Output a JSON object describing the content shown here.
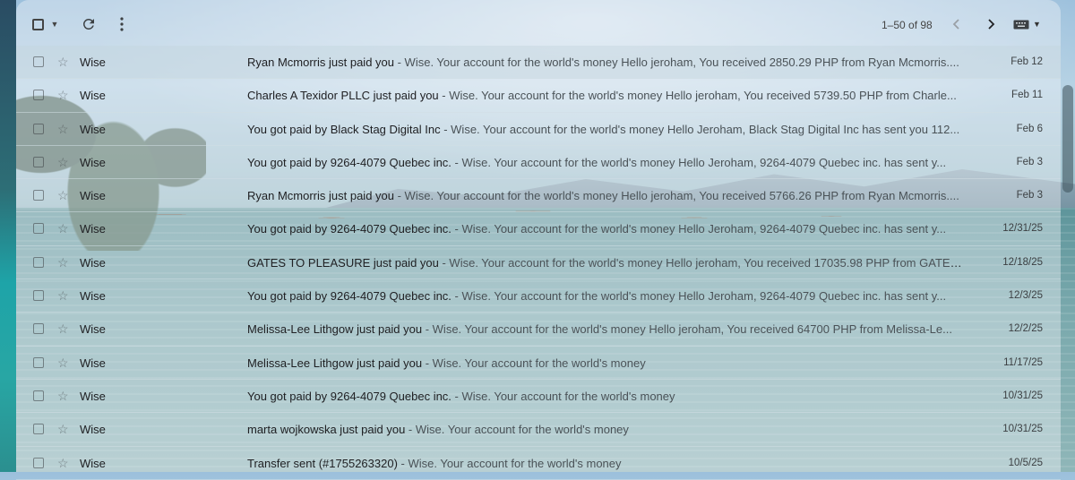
{
  "toolbar": {
    "pagination_label": "1–50 of 98"
  },
  "emails": [
    {
      "sender": "Wise",
      "subject": "Ryan Mcmorris just paid you",
      "snippet": " - Wise. Your account for the world's money Hello jeroham, You received 2850.29 PHP from Ryan Mcmorris....",
      "date": "Feb 12"
    },
    {
      "sender": "Wise",
      "subject": "Charles A Texidor PLLC just paid you",
      "snippet": " - Wise. Your account for the world's money Hello jeroham, You received 5739.50 PHP from Charle...",
      "date": "Feb 11"
    },
    {
      "sender": "Wise",
      "subject": "You got paid by Black Stag Digital Inc",
      "snippet": " - Wise. Your account for the world's money Hello Jeroham, Black Stag Digital Inc has sent you 112...",
      "date": "Feb 6"
    },
    {
      "sender": "Wise",
      "subject": "You got paid by 9264-4079 Quebec inc.",
      "snippet": " - Wise. Your account for the world's money Hello Jeroham, 9264-4079 Quebec inc. has sent y...",
      "date": "Feb 3"
    },
    {
      "sender": "Wise",
      "subject": "Ryan Mcmorris just paid you",
      "snippet": " - Wise. Your account for the world's money Hello jeroham, You received 5766.26 PHP from Ryan Mcmorris....",
      "date": "Feb 3"
    },
    {
      "sender": "Wise",
      "subject": "You got paid by 9264-4079 Quebec inc.",
      "snippet": " - Wise. Your account for the world's money Hello Jeroham, 9264-4079 Quebec inc. has sent y...",
      "date": "12/31/25"
    },
    {
      "sender": "Wise",
      "subject": "GATES TO PLEASURE just paid you",
      "snippet": " - Wise. Your account for the world's money Hello jeroham, You received 17035.98 PHP from GATES ...",
      "date": "12/18/25"
    },
    {
      "sender": "Wise",
      "subject": "You got paid by 9264-4079 Quebec inc.",
      "snippet": " - Wise. Your account for the world's money Hello Jeroham, 9264-4079 Quebec inc. has sent y...",
      "date": "12/3/25"
    },
    {
      "sender": "Wise",
      "subject": "Melissa-Lee Lithgow just paid you",
      "snippet": " - Wise. Your account for the world's money Hello jeroham, You received 64700 PHP from Melissa-Le...",
      "date": "12/2/25"
    },
    {
      "sender": "Wise",
      "subject": "Melissa-Lee Lithgow just paid you",
      "snippet": " - Wise. Your account for the world's money",
      "date": "11/17/25"
    },
    {
      "sender": "Wise",
      "subject": "You got paid by 9264-4079 Quebec inc.",
      "snippet": " - Wise. Your account for the world's money",
      "date": "10/31/25"
    },
    {
      "sender": "Wise",
      "subject": "marta wojkowska just paid you",
      "snippet": " - Wise. Your account for the world's money",
      "date": "10/31/25"
    },
    {
      "sender": "Wise",
      "subject": "Transfer sent (#1755263320)",
      "snippet": " - Wise. Your account for the world's money",
      "date": "10/5/25"
    }
  ]
}
